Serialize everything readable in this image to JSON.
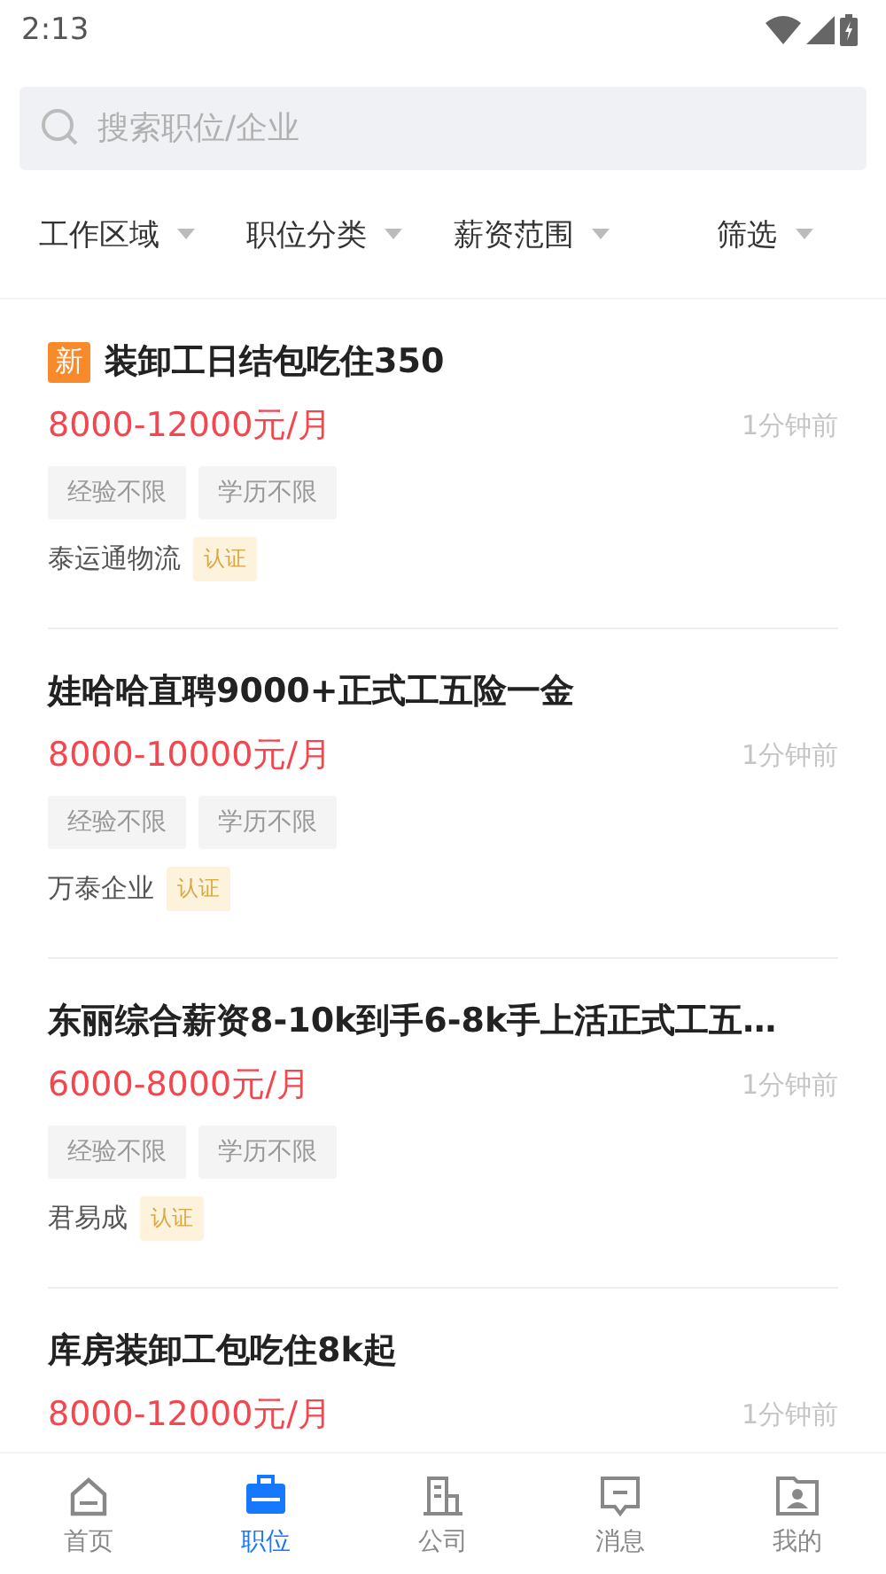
{
  "status_bar": {
    "time": "2:13"
  },
  "search": {
    "placeholder": "搜索职位/企业"
  },
  "filters": [
    {
      "label": "工作区域"
    },
    {
      "label": "职位分类"
    },
    {
      "label": "薪资范围"
    },
    {
      "label": "筛选"
    }
  ],
  "jobs": [
    {
      "badge": "新",
      "title": "装卸工日结包吃住350",
      "salary": "8000-12000元/月",
      "time": "1分钟前",
      "tags": [
        "经验不限",
        "学历不限"
      ],
      "company": "泰运通物流",
      "verified": "认证"
    },
    {
      "title": "娃哈哈直聘9000+正式工五险一金",
      "salary": "8000-10000元/月",
      "time": "1分钟前",
      "tags": [
        "经验不限",
        "学历不限"
      ],
      "company": "万泰企业",
      "verified": "认证"
    },
    {
      "title": "东丽综合薪资8-10k到手6-8k手上活正式工五…",
      "salary": "6000-8000元/月",
      "time": "1分钟前",
      "tags": [
        "经验不限",
        "学历不限"
      ],
      "company": "君易成",
      "verified": "认证"
    },
    {
      "title": "库房装卸工包吃住8k起",
      "salary": "8000-12000元/月",
      "time": "1分钟前"
    }
  ],
  "bottom_nav": [
    {
      "label": "首页",
      "kind": "home",
      "selected": false
    },
    {
      "label": "职位",
      "kind": "jobs",
      "selected": true
    },
    {
      "label": "公司",
      "kind": "company",
      "selected": false
    },
    {
      "label": "消息",
      "kind": "message",
      "selected": false
    },
    {
      "label": "我的",
      "kind": "profile",
      "selected": false
    }
  ]
}
